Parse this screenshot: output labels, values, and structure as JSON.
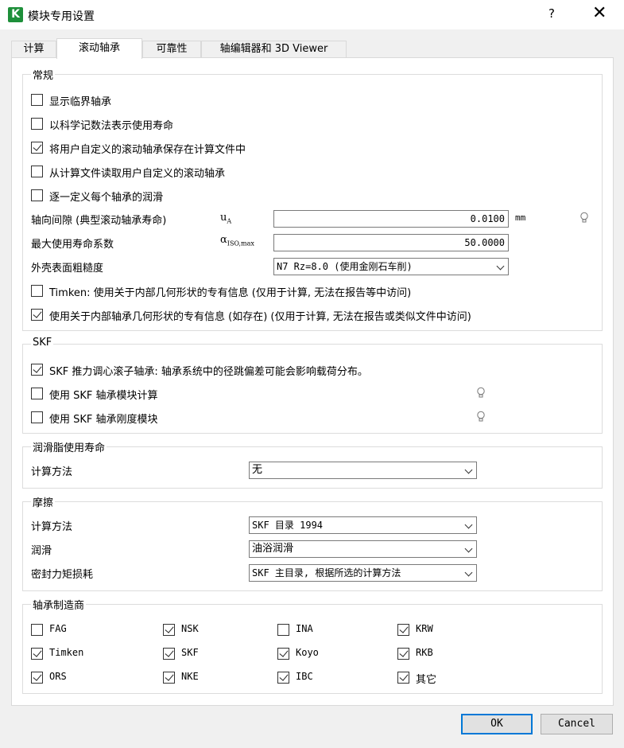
{
  "window": {
    "title": "模块专用设置",
    "app_icon_letter": "K",
    "help": "?",
    "close": "✕"
  },
  "tabs": [
    {
      "label": "计算"
    },
    {
      "label": "滚动轴承"
    },
    {
      "label": "可靠性"
    },
    {
      "label": "轴编辑器和 3D Viewer"
    }
  ],
  "general": {
    "title": "常规",
    "checks": [
      {
        "label": "显示临界轴承",
        "checked": false
      },
      {
        "label": "以科学记数法表示使用寿命",
        "checked": false
      },
      {
        "label": "将用户自定义的滚动轴承保存在计算文件中",
        "checked": true
      },
      {
        "label": "从计算文件读取用户自定义的滚动轴承",
        "checked": false
      },
      {
        "label": "逐一定义每个轴承的润滑",
        "checked": false
      }
    ],
    "clearance": {
      "label": "轴向间隙 (典型滚动轴承寿命)",
      "symbol": "u",
      "symbol_sub": "A",
      "value": "0.0100",
      "unit": "mm"
    },
    "max_life": {
      "label": "最大使用寿命系数",
      "symbol": "α",
      "symbol_sub": "ISO,max",
      "value": "50.0000"
    },
    "roughness": {
      "label": "外壳表面粗糙度",
      "value": "N7  Rz=8.0 (使用金刚石车削)"
    },
    "timken_check": {
      "label": "Timken: 使用关于内部几何形状的专有信息 (仅用于计算, 无法在报告等中访问)",
      "checked": false
    },
    "internal_check": {
      "label": "使用关于内部轴承几何形状的专有信息 (如存在) (仅用于计算, 无法在报告或类似文件中访问)",
      "checked": true
    }
  },
  "skf": {
    "title": "SKF",
    "checks": [
      {
        "label": "SKF 推力调心滚子轴承: 轴承系统中的径跳偏差可能会影响载荷分布。",
        "checked": true
      },
      {
        "label": "使用 SKF 轴承模块计算",
        "checked": false
      },
      {
        "label": "使用 SKF 轴承刚度模块",
        "checked": false
      }
    ]
  },
  "grease": {
    "title": "润滑脂使用寿命",
    "method_label": "计算方法",
    "method_value": "无"
  },
  "friction": {
    "title": "摩擦",
    "method_label": "计算方法",
    "method_value": "SKF 目录 1994",
    "lube_label": "润滑",
    "lube_value": "油浴润滑",
    "seal_label": "密封力矩损耗",
    "seal_value": "SKF 主目录, 根据所选的计算方法"
  },
  "manufacturers": {
    "title": "轴承制造商",
    "items": [
      {
        "label": "FAG",
        "checked": false
      },
      {
        "label": "NSK",
        "checked": true
      },
      {
        "label": "INA",
        "checked": false
      },
      {
        "label": "KRW",
        "checked": true
      },
      {
        "label": "Timken",
        "checked": true
      },
      {
        "label": "SKF",
        "checked": true
      },
      {
        "label": "Koyo",
        "checked": true
      },
      {
        "label": "RKB",
        "checked": true
      },
      {
        "label": "ORS",
        "checked": true
      },
      {
        "label": "NKE",
        "checked": true
      },
      {
        "label": "IBC",
        "checked": true
      },
      {
        "label": "其它",
        "checked": true
      }
    ]
  },
  "buttons": {
    "ok": "OK",
    "cancel": "Cancel"
  },
  "colors": {
    "accent": "#0078d7",
    "app_icon": "#1e8f3a"
  }
}
